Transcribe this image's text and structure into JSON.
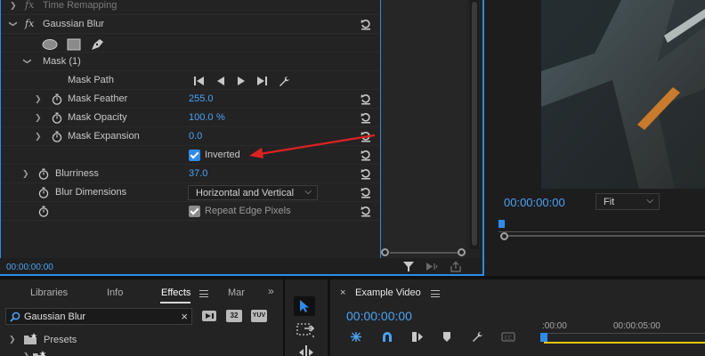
{
  "effect_controls": {
    "partial_top_label": "Time Remapping",
    "effect_name": "Gaussian Blur",
    "mask_label": "Mask (1)",
    "mask_path_label": "Mask Path",
    "mask_feather_label": "Mask Feather",
    "mask_feather_value": "255.0",
    "mask_opacity_label": "Mask Opacity",
    "mask_opacity_value": "100.0",
    "mask_opacity_unit": "%",
    "mask_expansion_label": "Mask Expansion",
    "mask_expansion_value": "0.0",
    "inverted_label": "Inverted",
    "blurriness_label": "Blurriness",
    "blurriness_value": "37.0",
    "blur_dimensions_label": "Blur Dimensions",
    "blur_dimensions_value": "Horizontal and Vertical",
    "repeat_edge_label": "Repeat Edge Pixels",
    "footer_timecode": "00:00:00:00"
  },
  "program_monitor": {
    "timecode": "00:00:00:00",
    "zoom": "Fit"
  },
  "effects_panel": {
    "tabs": [
      "Libraries",
      "Info",
      "Effects",
      "Mar"
    ],
    "search_value": "Gaussian Blur",
    "badge_32": "32",
    "badge_yuv": "YUV",
    "presets_label": "Presets"
  },
  "timeline": {
    "sequence_name": "Example Video",
    "timecode": "00:00:00:00",
    "ruler_labels": [
      ":00:00",
      "00:00:05:00"
    ]
  },
  "colors": {
    "accent_blue": "#2d8ceb",
    "value_blue": "#4aa3f7",
    "annotation_red": "#e02020",
    "in_out_yellow": "#e6c50a"
  }
}
